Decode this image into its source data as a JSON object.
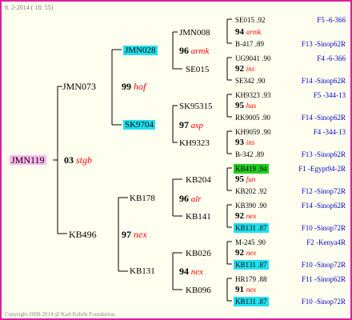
{
  "header": {
    "date": "8.  2-2014 ( 18: 55)"
  },
  "footer": {
    "copyright": "Copyright 2008-2014 @ Karl Kehrle Foundation."
  },
  "root": {
    "name": "JMN119",
    "year": "03",
    "mark": "stgb"
  },
  "gen1": [
    {
      "name": "JMN073",
      "year": "99",
      "mark": "hof"
    },
    {
      "name": "KB496",
      "year": "97",
      "mark": "nex"
    }
  ],
  "gen2": [
    {
      "name": "JMN028",
      "year": "96",
      "mark": "armk"
    },
    {
      "name": "SK9704",
      "year": "97",
      "mark": "asp"
    },
    {
      "name": "KB178",
      "year": "96",
      "mark": "alr"
    },
    {
      "name": "KB131",
      "year": "94",
      "mark": "nex"
    }
  ],
  "gen3": [
    {
      "name": "JMN008",
      "year": "94",
      "mark": "armk"
    },
    {
      "name": "SE015",
      "year": "92",
      "mark": "ins"
    },
    {
      "name": "SK95315",
      "year": "95",
      "mark": "has"
    },
    {
      "name": "KH9323",
      "year": "93",
      "mark": "ins"
    },
    {
      "name": "KB204",
      "year": "95",
      "mark": "fun"
    },
    {
      "name": "KB141",
      "year": "92",
      "mark": "nex"
    },
    {
      "name": "KB026",
      "year": "92",
      "mark": "nex"
    },
    {
      "name": "KB096",
      "year": "91",
      "mark": "nex"
    }
  ],
  "gen4": [
    {
      "name": "SE015 .92",
      "pedigree": "F5 -6-366"
    },
    {
      "name": "B-417 .89",
      "pedigree": "F13 -Sinop62R"
    },
    {
      "name": "UG9041 .90",
      "pedigree": "F4 -6-366"
    },
    {
      "name": "SE342 .90",
      "pedigree": "F14 -Sinop62R"
    },
    {
      "name": "KH9323 .93",
      "pedigree": "F5 -344-13"
    },
    {
      "name": "RK9005 .90",
      "pedigree": "F14 -Sinop62R"
    },
    {
      "name": "KH9059 .90",
      "pedigree": "F4 -344-13"
    },
    {
      "name": "B-342 .89",
      "pedigree": "F13 -Sinop62R"
    },
    {
      "name": "KB419 .94",
      "pedigree": "F1 -Egypt94-2R"
    },
    {
      "name": "KB202 .92",
      "pedigree": "F12 -Sinop72R"
    },
    {
      "name": "KB390 .90",
      "pedigree": "F14 -Sinop62R"
    },
    {
      "name": "KB131 .87",
      "pedigree": "F10 -Sinop72R"
    },
    {
      "name": "M-245 .90",
      "pedigree": "F2 -Kenya4R"
    },
    {
      "name": "KB131 .87",
      "pedigree": "F10 -Sinop72R"
    },
    {
      "name": "HR179 .88",
      "pedigree": "F11 -Sinop62R"
    },
    {
      "name": "KB131 .87",
      "pedigree": "F10 -Sinop72R"
    }
  ],
  "colors": {
    "frame": "#e0209a",
    "highlight_cyan": "#20e0f0",
    "highlight_green": "#22cc22",
    "root_bg": "#ffb6f0",
    "pedigree": "#0000cc",
    "mark": "#ff0000"
  }
}
